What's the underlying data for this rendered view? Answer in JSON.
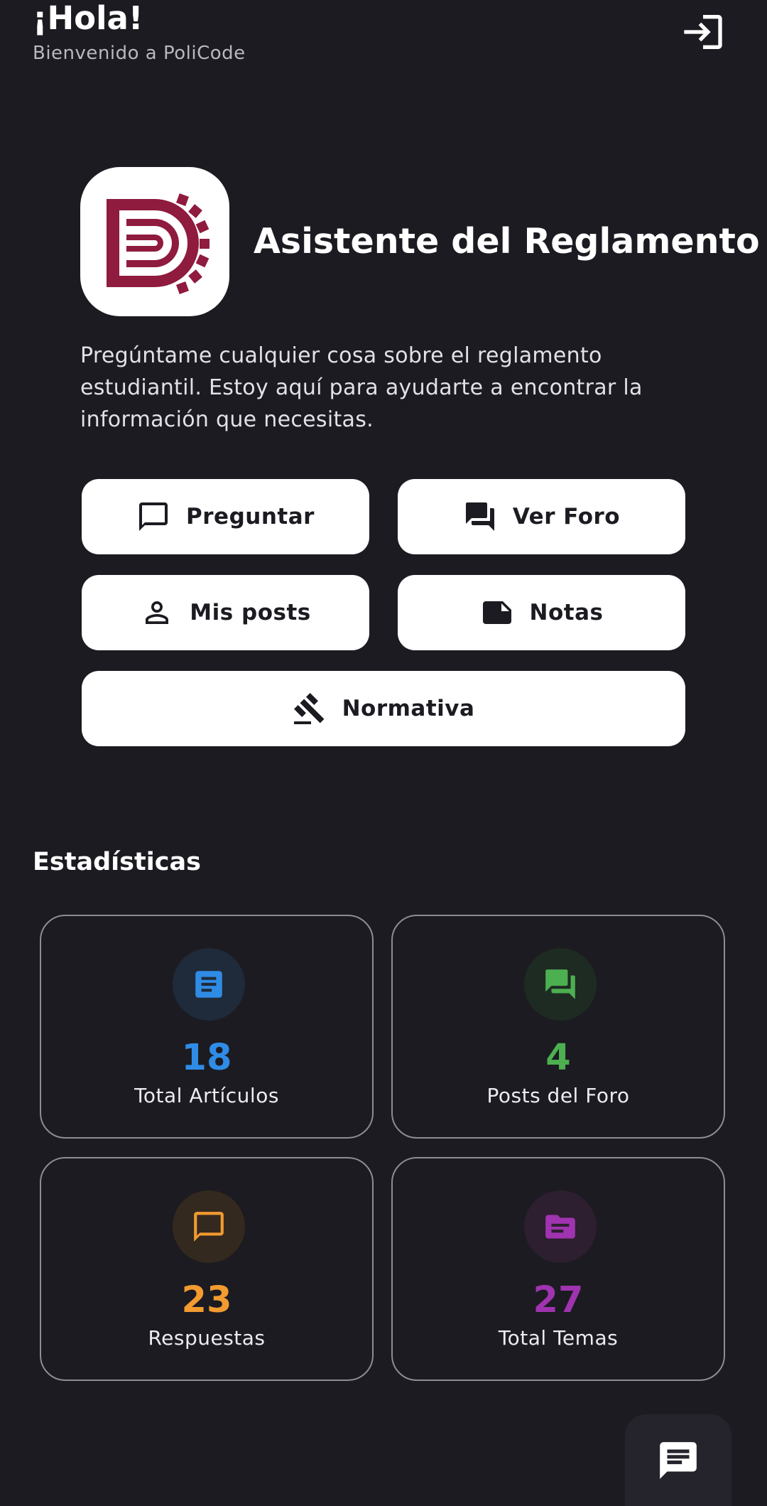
{
  "header": {
    "title": "¡Hola!",
    "subtitle": "Bienvenido a PoliCode",
    "logout_icon": "login-icon"
  },
  "assistant": {
    "logo_icon": "policode-logo",
    "title": "Asistente del Reglamento",
    "description": "Pregúntame cualquier cosa sobre el reglamento estudiantil. Estoy aquí para ayudarte a encontrar la información que necesitas.",
    "buttons": [
      {
        "label": "Preguntar",
        "icon": "chat-bubble-outline-icon"
      },
      {
        "label": "Ver Foro",
        "icon": "forum-icon"
      },
      {
        "label": "Mis posts",
        "icon": "person-outline-icon"
      },
      {
        "label": "Notas",
        "icon": "note-icon"
      },
      {
        "label": "Normativa",
        "icon": "gavel-icon"
      }
    ]
  },
  "stats": {
    "title": "Estadísticas",
    "cards": [
      {
        "value": "18",
        "label": "Total Artículos",
        "icon": "article-icon",
        "color": "#2f8ce6"
      },
      {
        "value": "4",
        "label": "Posts del Foro",
        "icon": "forum-icon",
        "color": "#4caf50"
      },
      {
        "value": "23",
        "label": "Respuestas",
        "icon": "chat-bubble-outline-icon",
        "color": "#f29b30"
      },
      {
        "value": "27",
        "label": "Total Temas",
        "icon": "topic-icon",
        "color": "#a033b0"
      }
    ]
  },
  "fab": {
    "icon": "chat-icon"
  },
  "colors": {
    "background": "#1c1b21",
    "brand": "#8f1b3f"
  }
}
